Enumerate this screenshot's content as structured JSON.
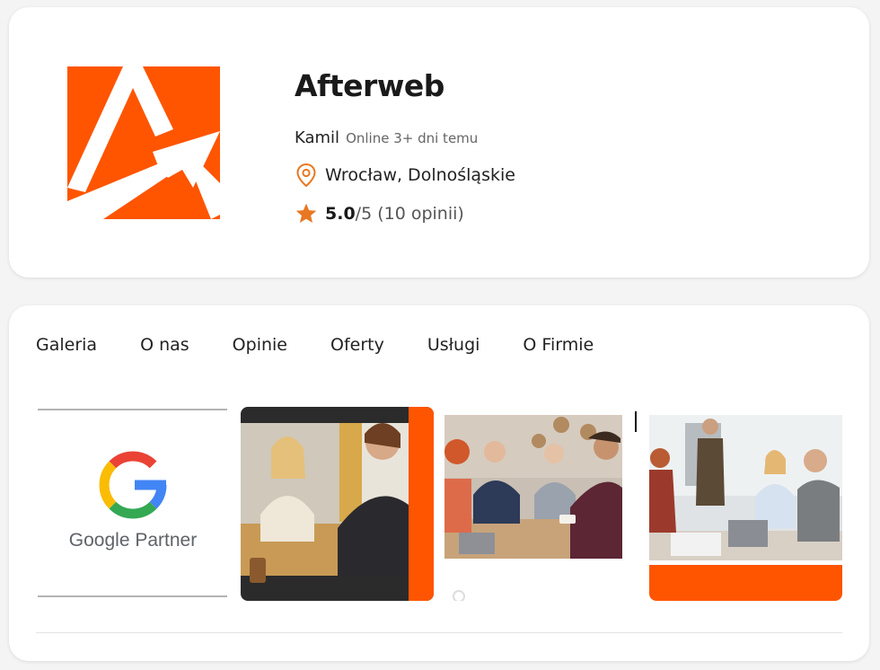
{
  "company": {
    "name": "Afterweb",
    "owner": "Kamil",
    "status": "Online 3+ dni temu",
    "location": "Wrocław, Dolnośląskie",
    "rating": "5.0",
    "rating_max": "/5",
    "reviews": "(10 opinii)",
    "accent_color": "#ff5500",
    "icon_color": "#e87722"
  },
  "tabs": [
    {
      "label": "Galeria"
    },
    {
      "label": "O nas"
    },
    {
      "label": "Opinie"
    },
    {
      "label": "Oferty"
    },
    {
      "label": "Usługi"
    },
    {
      "label": "O Firmie"
    }
  ],
  "gallery": [
    {
      "name": "google-partner-image",
      "caption": "Google Partner"
    },
    {
      "name": "team-photo-1"
    },
    {
      "name": "team-photo-2"
    },
    {
      "name": "team-photo-3"
    }
  ],
  "icons": {
    "location": "location-pin-icon",
    "rating": "star-icon"
  }
}
